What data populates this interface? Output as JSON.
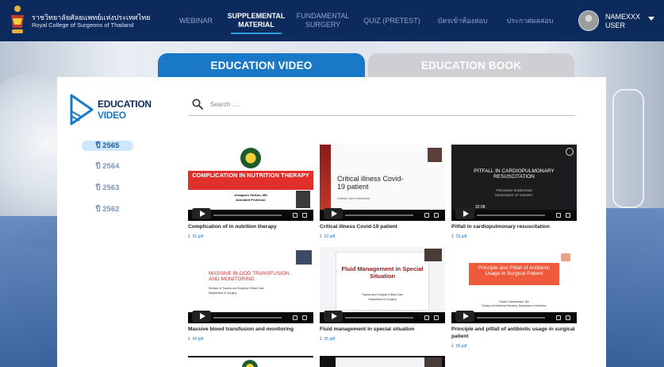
{
  "header": {
    "brand_th": "ราชวิทยาลัยศัลยแพทย์แห่งประเทศไทย",
    "brand_en": "Royal College of Surgeons of Thailand",
    "nav": [
      {
        "label1": "WEBINAR",
        "label2": ""
      },
      {
        "label1": "SUPPLEMENTAL",
        "label2": "MATERIAL"
      },
      {
        "label1": "FUNDAMENTAL",
        "label2": "SURGERY"
      },
      {
        "label1": "QUIZ (PRETEST)",
        "label2": ""
      },
      {
        "label1": "บัตรเข้าห้องสอบ",
        "label2": ""
      },
      {
        "label1": "ประกาศผลสอบ",
        "label2": ""
      }
    ],
    "active_nav": "SUPPLEMENTAL MATERIAL",
    "user_line1": "NAMEXXX",
    "user_line2": "USER"
  },
  "tabs": {
    "video": "EDUCATION VIDEO",
    "book": "EDUCATION BOOK"
  },
  "sidebar": {
    "title1": "EDUCATION",
    "title2": "VIDEO",
    "years": [
      "ปี 2565",
      "ปี 2564",
      "ปี 2563",
      "ปี 2562"
    ],
    "active_year": "ปี 2565"
  },
  "search": {
    "placeholder": "Search ....",
    "value": ""
  },
  "videos": [
    {
      "title": "Complication of in nutrition therapy",
      "pdf": "01.pdf",
      "duration": "31:46",
      "slide_title": "COMPLICATION IN NUTRITION THERAPY",
      "slide_sub1": "Jetsaporn Sirikun, MD",
      "slide_sub2": "Assistant Professor"
    },
    {
      "title": "Critical illness Covid-19 patient",
      "pdf": "02.pdf",
      "duration": "35:21",
      "slide_title": "Critical illness Covid-19 patient",
      "slide_sub1": "Critical Care Intensivist",
      "slide_sub2": ""
    },
    {
      "title": "Pitfall in cardiopulmonary resuscitation",
      "pdf": "03.pdf",
      "duration": "32:08",
      "slide_title": "PITFALL IN CARDIOPULMONARY RESUSCITATION",
      "slide_sub1": "PREEDAWAT SOMBOONNA",
      "slide_sub2": "DEPARTMENT OF SURGERY"
    },
    {
      "title": "Massive blood transfusion and monitoring",
      "pdf": "04.pdf",
      "duration": "29:34",
      "slide_title": "MASSIVE BLOOD TRANSFUSION AND MONITORING",
      "slide_sub1": "Division of Trauma and Surgical Critical Care",
      "slide_sub2": "Department of Surgery"
    },
    {
      "title": "Fluid management in special situation",
      "pdf": "05.pdf",
      "duration": "37:41",
      "slide_title": "Fluid Management in Special Situation",
      "slide_sub1": "Trauma and Surgical Critical Care",
      "slide_sub2": "Department of Surgery"
    },
    {
      "title": "Principle and pitfall of antibiotic usage in surgical patient",
      "pdf": "06.pdf",
      "duration": "30:59",
      "slide_title": "Principle and Pitfall of Antibiotic Usage in Surgical Patient",
      "slide_sub1": "Pawee Chantharakul, MD",
      "slide_sub2": "Division of Infectious Diseases, Department of Medicine"
    }
  ],
  "colors": {
    "header_bg": "#0d2a5c",
    "accent": "#1a79c6",
    "tab_inactive": "#cdcfd2"
  }
}
